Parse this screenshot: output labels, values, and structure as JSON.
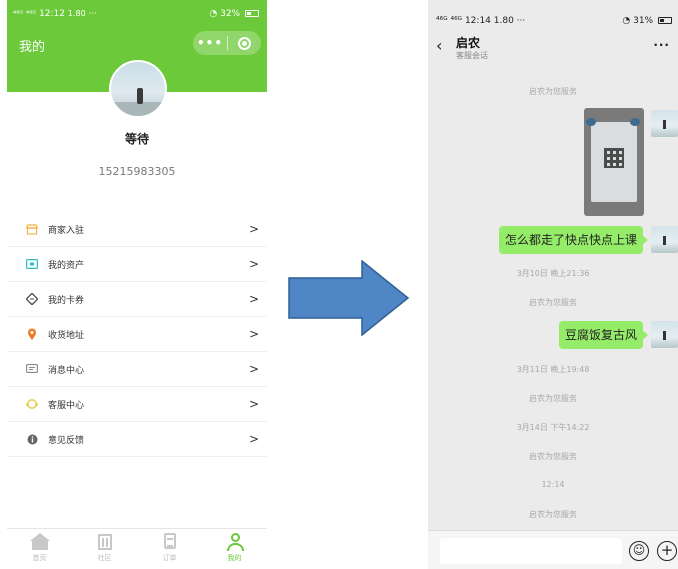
{
  "left": {
    "status": {
      "signal": "⁴⁶ᴳ ⁴⁶ᴳ",
      "time": "12:12",
      "speed": "1.80",
      "dots": "···",
      "right": "32%"
    },
    "header": {
      "title": "我的",
      "capsule_more": "•••"
    },
    "profile": {
      "nickname": "等待",
      "phone": "15215983305"
    },
    "menu": [
      {
        "label": "商家入驻",
        "icon": "store-icon",
        "color": "#f3b13b"
      },
      {
        "label": "我的资产",
        "icon": "wallet-icon",
        "color": "#2bbfc0"
      },
      {
        "label": "我的卡券",
        "icon": "coupon-icon",
        "color": "#444444"
      },
      {
        "label": "收货地址",
        "icon": "location-icon",
        "color": "#f07c2a"
      },
      {
        "label": "消息中心",
        "icon": "message-icon",
        "color": "#888888"
      },
      {
        "label": "客服中心",
        "icon": "service-icon",
        "color": "#e8c33a"
      },
      {
        "label": "意见反馈",
        "icon": "info-icon",
        "color": "#666666"
      }
    ],
    "tabs": [
      {
        "label": "首页",
        "icon": "home-icon"
      },
      {
        "label": "社区",
        "icon": "building-icon"
      },
      {
        "label": "订单",
        "icon": "order-icon"
      },
      {
        "label": "我的",
        "icon": "profile-icon",
        "active": true
      }
    ],
    "accent": "#6bc93a"
  },
  "right": {
    "status": {
      "signal": "⁴⁶ᴳ ⁴⁶ᴳ",
      "time": "12:14",
      "speed": "1.80",
      "dots": "···",
      "right": "31%"
    },
    "nav": {
      "title": "启农",
      "subtitle": "客服会话",
      "more": "···"
    },
    "messages": {
      "sys1": "启农为您服务",
      "bubble1": "怎么都走了快点快点上课",
      "time1": "3月10日 晚上21:36",
      "sys2": "启农为您服务",
      "bubble2": "豆腐饭复古风",
      "time2": "3月11日 晚上19:48",
      "sys3": "启农为您服务",
      "time3": "3月14日 下午14:22",
      "sys4": "启农为您服务",
      "time4": "12:14",
      "sys5": "启农为您服务"
    },
    "bubble_color": "#95ec69",
    "chat_bg": "#ebebeb"
  },
  "arrow_color": "#4f86c6"
}
